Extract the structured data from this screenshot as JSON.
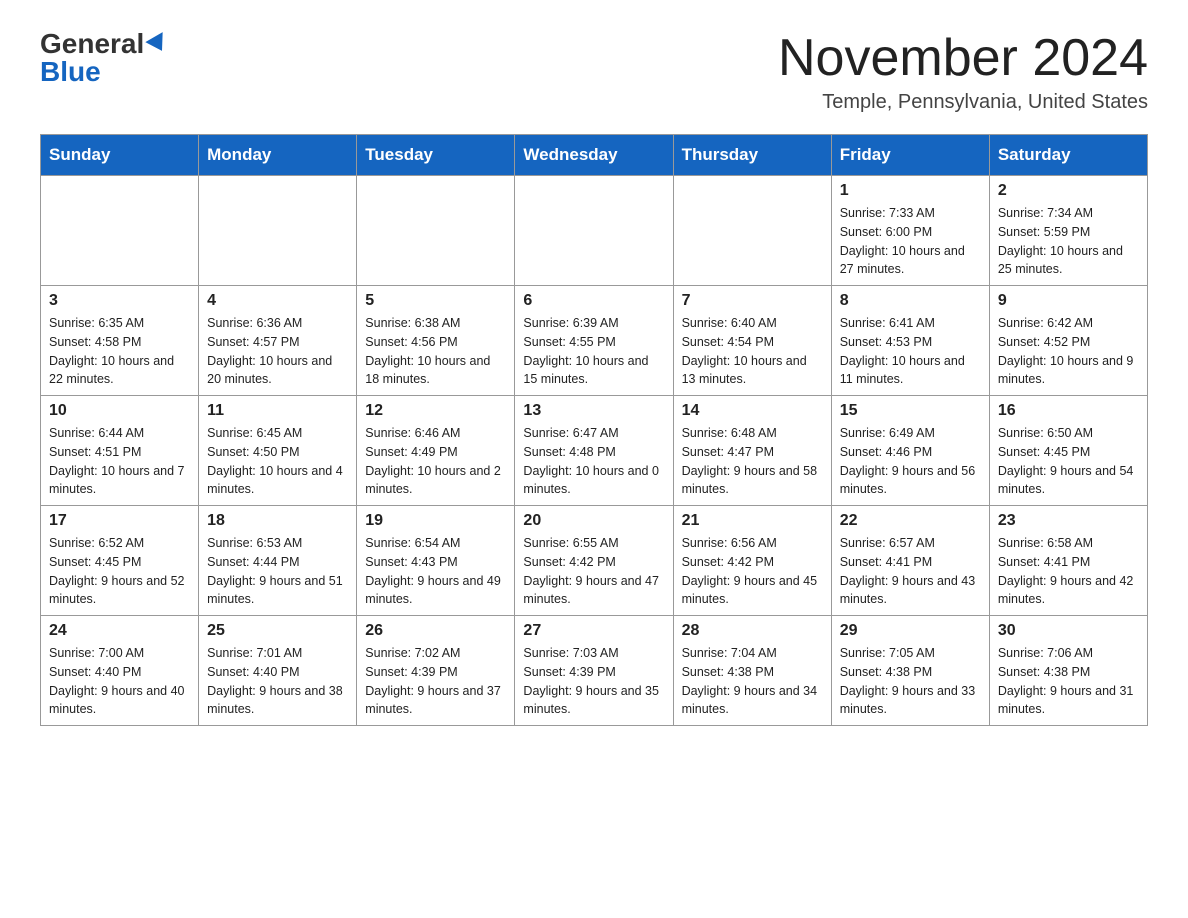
{
  "logo": {
    "general": "General",
    "blue": "Blue"
  },
  "title": "November 2024",
  "location": "Temple, Pennsylvania, United States",
  "weekdays": [
    "Sunday",
    "Monday",
    "Tuesday",
    "Wednesday",
    "Thursday",
    "Friday",
    "Saturday"
  ],
  "weeks": [
    [
      {
        "day": "",
        "info": ""
      },
      {
        "day": "",
        "info": ""
      },
      {
        "day": "",
        "info": ""
      },
      {
        "day": "",
        "info": ""
      },
      {
        "day": "",
        "info": ""
      },
      {
        "day": "1",
        "info": "Sunrise: 7:33 AM\nSunset: 6:00 PM\nDaylight: 10 hours and 27 minutes."
      },
      {
        "day": "2",
        "info": "Sunrise: 7:34 AM\nSunset: 5:59 PM\nDaylight: 10 hours and 25 minutes."
      }
    ],
    [
      {
        "day": "3",
        "info": "Sunrise: 6:35 AM\nSunset: 4:58 PM\nDaylight: 10 hours and 22 minutes."
      },
      {
        "day": "4",
        "info": "Sunrise: 6:36 AM\nSunset: 4:57 PM\nDaylight: 10 hours and 20 minutes."
      },
      {
        "day": "5",
        "info": "Sunrise: 6:38 AM\nSunset: 4:56 PM\nDaylight: 10 hours and 18 minutes."
      },
      {
        "day": "6",
        "info": "Sunrise: 6:39 AM\nSunset: 4:55 PM\nDaylight: 10 hours and 15 minutes."
      },
      {
        "day": "7",
        "info": "Sunrise: 6:40 AM\nSunset: 4:54 PM\nDaylight: 10 hours and 13 minutes."
      },
      {
        "day": "8",
        "info": "Sunrise: 6:41 AM\nSunset: 4:53 PM\nDaylight: 10 hours and 11 minutes."
      },
      {
        "day": "9",
        "info": "Sunrise: 6:42 AM\nSunset: 4:52 PM\nDaylight: 10 hours and 9 minutes."
      }
    ],
    [
      {
        "day": "10",
        "info": "Sunrise: 6:44 AM\nSunset: 4:51 PM\nDaylight: 10 hours and 7 minutes."
      },
      {
        "day": "11",
        "info": "Sunrise: 6:45 AM\nSunset: 4:50 PM\nDaylight: 10 hours and 4 minutes."
      },
      {
        "day": "12",
        "info": "Sunrise: 6:46 AM\nSunset: 4:49 PM\nDaylight: 10 hours and 2 minutes."
      },
      {
        "day": "13",
        "info": "Sunrise: 6:47 AM\nSunset: 4:48 PM\nDaylight: 10 hours and 0 minutes."
      },
      {
        "day": "14",
        "info": "Sunrise: 6:48 AM\nSunset: 4:47 PM\nDaylight: 9 hours and 58 minutes."
      },
      {
        "day": "15",
        "info": "Sunrise: 6:49 AM\nSunset: 4:46 PM\nDaylight: 9 hours and 56 minutes."
      },
      {
        "day": "16",
        "info": "Sunrise: 6:50 AM\nSunset: 4:45 PM\nDaylight: 9 hours and 54 minutes."
      }
    ],
    [
      {
        "day": "17",
        "info": "Sunrise: 6:52 AM\nSunset: 4:45 PM\nDaylight: 9 hours and 52 minutes."
      },
      {
        "day": "18",
        "info": "Sunrise: 6:53 AM\nSunset: 4:44 PM\nDaylight: 9 hours and 51 minutes."
      },
      {
        "day": "19",
        "info": "Sunrise: 6:54 AM\nSunset: 4:43 PM\nDaylight: 9 hours and 49 minutes."
      },
      {
        "day": "20",
        "info": "Sunrise: 6:55 AM\nSunset: 4:42 PM\nDaylight: 9 hours and 47 minutes."
      },
      {
        "day": "21",
        "info": "Sunrise: 6:56 AM\nSunset: 4:42 PM\nDaylight: 9 hours and 45 minutes."
      },
      {
        "day": "22",
        "info": "Sunrise: 6:57 AM\nSunset: 4:41 PM\nDaylight: 9 hours and 43 minutes."
      },
      {
        "day": "23",
        "info": "Sunrise: 6:58 AM\nSunset: 4:41 PM\nDaylight: 9 hours and 42 minutes."
      }
    ],
    [
      {
        "day": "24",
        "info": "Sunrise: 7:00 AM\nSunset: 4:40 PM\nDaylight: 9 hours and 40 minutes."
      },
      {
        "day": "25",
        "info": "Sunrise: 7:01 AM\nSunset: 4:40 PM\nDaylight: 9 hours and 38 minutes."
      },
      {
        "day": "26",
        "info": "Sunrise: 7:02 AM\nSunset: 4:39 PM\nDaylight: 9 hours and 37 minutes."
      },
      {
        "day": "27",
        "info": "Sunrise: 7:03 AM\nSunset: 4:39 PM\nDaylight: 9 hours and 35 minutes."
      },
      {
        "day": "28",
        "info": "Sunrise: 7:04 AM\nSunset: 4:38 PM\nDaylight: 9 hours and 34 minutes."
      },
      {
        "day": "29",
        "info": "Sunrise: 7:05 AM\nSunset: 4:38 PM\nDaylight: 9 hours and 33 minutes."
      },
      {
        "day": "30",
        "info": "Sunrise: 7:06 AM\nSunset: 4:38 PM\nDaylight: 9 hours and 31 minutes."
      }
    ]
  ]
}
